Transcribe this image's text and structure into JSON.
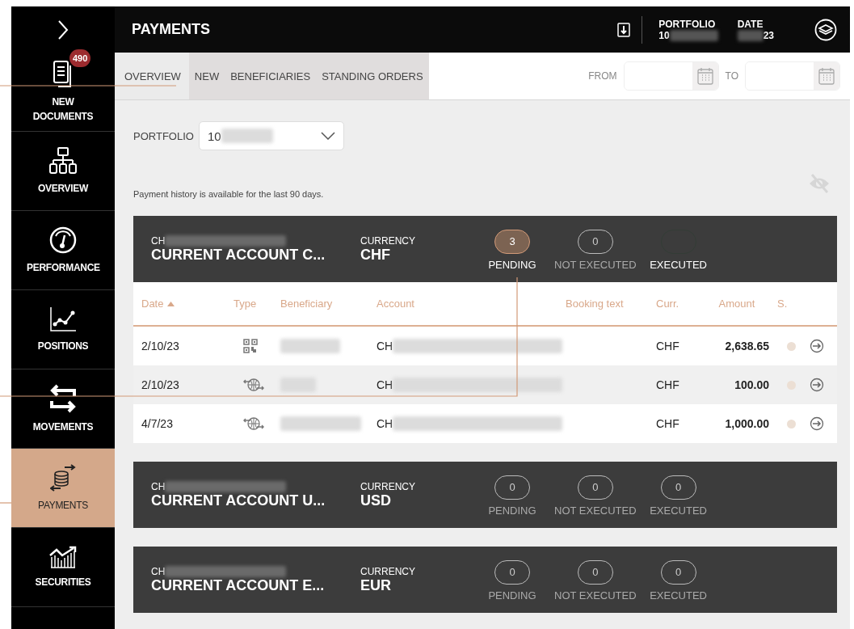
{
  "sidebar": {
    "items": [
      {
        "label": "NEW DOCUMENTS",
        "badge": "490",
        "selected": false
      },
      {
        "label": "OVERVIEW",
        "selected": false
      },
      {
        "label": "PERFORMANCE",
        "selected": false
      },
      {
        "label": "POSITIONS",
        "selected": false
      },
      {
        "label": "MOVEMENTS",
        "selected": false
      },
      {
        "label": "PAYMENTS",
        "selected": true
      },
      {
        "label": "SECURITIES",
        "selected": false
      }
    ]
  },
  "header": {
    "title": "PAYMENTS",
    "portfolio": {
      "label": "PORTFOLIO",
      "value": "10"
    },
    "date": {
      "label": "DATE",
      "value": "23"
    }
  },
  "tabs": [
    {
      "label": "OVERVIEW",
      "selected": true
    },
    {
      "label": "NEW",
      "selected": false
    },
    {
      "label": "BENEFICIARIES",
      "selected": false
    },
    {
      "label": "STANDING ORDERS",
      "selected": false
    }
  ],
  "date_range": {
    "from_label": "FROM",
    "to_label": "TO"
  },
  "portfolio_select": {
    "label": "PORTFOLIO",
    "value": "10"
  },
  "note": "Payment history is available for the last 90 days.",
  "accounts": [
    {
      "number": "CH",
      "name": "CURRENT ACCOUNT C...",
      "currency_label": "CURRENCY",
      "currency": "CHF",
      "statuses": [
        {
          "label": "PENDING",
          "count": "3",
          "kind": "active"
        },
        {
          "label": "NOT EXECUTED",
          "count": "0",
          "kind": "idle"
        },
        {
          "label": "EXECUTED",
          "kind": "hidden"
        }
      ],
      "table": {
        "columns": [
          {
            "label": "Date",
            "sorted": true
          },
          {
            "label": "Type",
            "sorted": false
          },
          {
            "label": "Beneficiary",
            "sorted": false
          },
          {
            "label": "Account",
            "sorted": false
          },
          {
            "label": "Booking text",
            "sorted": false
          },
          {
            "label": "Curr.",
            "sorted": false
          },
          {
            "label": "Amount",
            "sorted": false
          },
          {
            "label": "S.",
            "sorted": false
          }
        ],
        "rows": [
          {
            "date": "2/10/23",
            "kind": "qr",
            "account": "CH",
            "currency": "CHF",
            "amount": "2,638.65",
            "color": "#ecdfd4"
          },
          {
            "date": "2/10/23",
            "kind": "international",
            "account": "CH",
            "currency": "CHF",
            "amount": "100.00",
            "color": "#ecdfd4"
          },
          {
            "date": "4/7/23",
            "kind": "international",
            "account": "CH",
            "currency": "CHF",
            "amount": "1,000.00",
            "color": "#ecdfd4"
          }
        ]
      }
    },
    {
      "number": "CH",
      "name": "CURRENT ACCOUNT U...",
      "currency_label": "CURRENCY",
      "currency": "USD",
      "statuses": [
        {
          "label": "PENDING",
          "count": "0",
          "kind": "idle"
        },
        {
          "label": "NOT EXECUTED",
          "count": "0",
          "kind": "idle"
        },
        {
          "label": "EXECUTED",
          "count": "0",
          "kind": "idle"
        }
      ]
    },
    {
      "number": "CH",
      "name": "CURRENT ACCOUNT E...",
      "currency_label": "CURRENCY",
      "currency": "EUR",
      "statuses": [
        {
          "label": "PENDING",
          "count": "0",
          "kind": "idle"
        },
        {
          "label": "NOT EXECUTED",
          "count": "0",
          "kind": "idle"
        },
        {
          "label": "EXECUTED",
          "count": "0",
          "kind": "idle"
        }
      ]
    }
  ]
}
